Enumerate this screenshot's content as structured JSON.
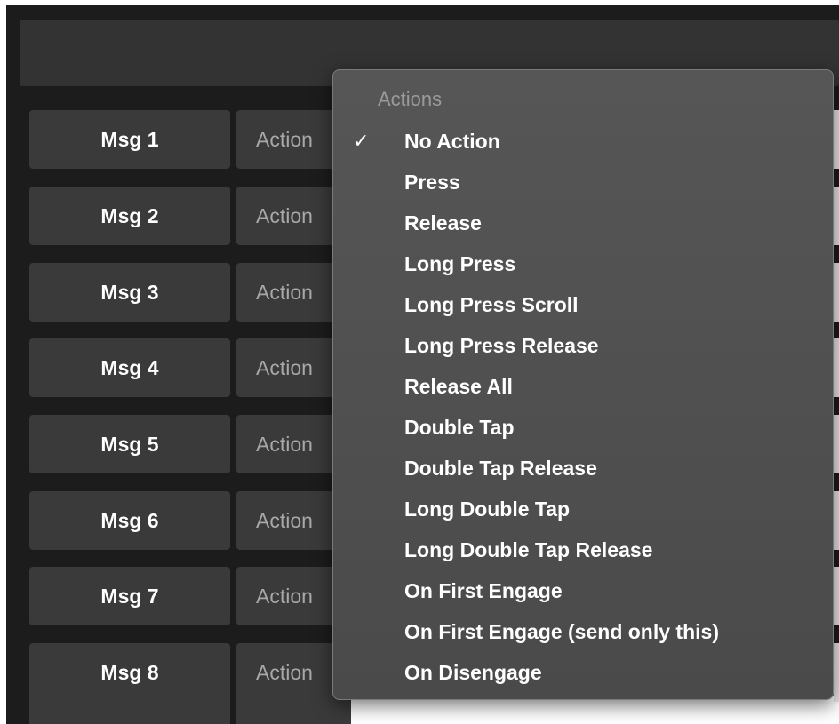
{
  "rows": [
    {
      "msg_label": "Msg 1",
      "action_label": "Action"
    },
    {
      "msg_label": "Msg 2",
      "action_label": "Action"
    },
    {
      "msg_label": "Msg 3",
      "action_label": "Action"
    },
    {
      "msg_label": "Msg 4",
      "action_label": "Action"
    },
    {
      "msg_label": "Msg 5",
      "action_label": "Action"
    },
    {
      "msg_label": "Msg 6",
      "action_label": "Action"
    },
    {
      "msg_label": "Msg 7",
      "action_label": "Action"
    },
    {
      "msg_label": "Msg 8",
      "action_label": "Action"
    }
  ],
  "menu": {
    "header": "Actions",
    "check_glyph": "✓",
    "selected": "No Action",
    "items": [
      {
        "label": "No Action",
        "checked": true
      },
      {
        "label": "Press",
        "checked": false
      },
      {
        "label": "Release",
        "checked": false
      },
      {
        "label": "Long Press",
        "checked": false
      },
      {
        "label": "Long Press Scroll",
        "checked": false
      },
      {
        "label": "Long Press Release",
        "checked": false
      },
      {
        "label": "Release All",
        "checked": false
      },
      {
        "label": "Double Tap",
        "checked": false
      },
      {
        "label": "Double Tap Release",
        "checked": false
      },
      {
        "label": "Long Double Tap",
        "checked": false
      },
      {
        "label": "Long Double Tap Release",
        "checked": false
      },
      {
        "label": "On First Engage",
        "checked": false
      },
      {
        "label": "On First Engage (send only this)",
        "checked": false
      },
      {
        "label": "On Disengage",
        "checked": false
      }
    ]
  },
  "colors": {
    "background": "#1c1c1c",
    "button": "#3a3a3a",
    "menu": "#505050",
    "text": "#ffffff",
    "muted_text": "#a8a8a8"
  }
}
